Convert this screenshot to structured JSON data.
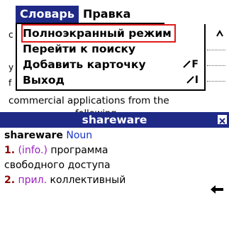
{
  "menubar": {
    "menus": [
      {
        "label": "Словарь",
        "active": true
      },
      {
        "label": "Правка",
        "active": false
      }
    ]
  },
  "dropdown": {
    "items": [
      {
        "label": "Полноэкранный режим",
        "shortcut": "",
        "highlighted": true
      },
      {
        "label": "Перейти к поиску",
        "shortcut": ""
      },
      {
        "label": "Добавить карточку",
        "shortcut": "F"
      },
      {
        "label": "Выход",
        "shortcut": "I"
      }
    ]
  },
  "background": {
    "sentence": "commercial applications from the",
    "sentence2": "...............following",
    "left_fragments": [
      "c",
      "y",
      "f"
    ]
  },
  "card": {
    "title": "shareware",
    "headword": "shareware",
    "pos": "Noun",
    "senses": [
      {
        "num": "1.",
        "tag": "(info.)",
        "text": "программа"
      },
      {
        "num": "",
        "tag": "",
        "text": "свободного доступа"
      },
      {
        "num": "2.",
        "tag": "прил.",
        "text": "коллективный"
      }
    ]
  },
  "colors": {
    "accent": "#1f2a87",
    "highlight_border": "#e11b1b",
    "pos": "#1a35c8",
    "sense_number": "#8b0000",
    "tag": "#9a1fc0"
  }
}
